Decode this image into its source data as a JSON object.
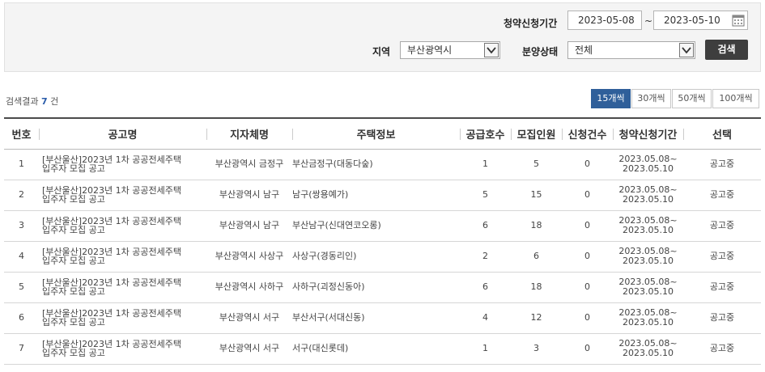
{
  "filters": {
    "period_label": "청약신청기간",
    "date_from": "2023-05-08",
    "date_sep": "~",
    "date_to": "2023-05-10",
    "region_label": "지역",
    "region_value": "부산광역시",
    "status_label": "분양상태",
    "status_value": "전체",
    "search_button": "검색"
  },
  "result": {
    "prefix": "검색결과",
    "count": "7",
    "suffix": "건"
  },
  "page_sizes": [
    "15개씩",
    "30개씩",
    "50개씩",
    "100개씩"
  ],
  "active_page_size": "15개씩",
  "table": {
    "headers": [
      "번호",
      "공고명",
      "지자체명",
      "주택정보",
      "공급호수",
      "모집인원",
      "신청건수",
      "청약신청기간",
      "선택"
    ],
    "rows": [
      {
        "no": "1",
        "title1": "[부산울산]2023년 1차 공공전세주택",
        "title2": "입주자 모집 공고",
        "gov": "부산광역시 금정구",
        "house": "부산금정구(대동다숲)",
        "supply": "1",
        "recruit": "5",
        "apply": "0",
        "date1": "2023.05.08~",
        "date2": "2023.05.10",
        "status": "공고중"
      },
      {
        "no": "2",
        "title1": "[부산울산]2023년 1차 공공전세주택",
        "title2": "입주자 모집 공고",
        "gov": "부산광역시 남구",
        "house": "남구(쌍용예가)",
        "supply": "5",
        "recruit": "15",
        "apply": "0",
        "date1": "2023.05.08~",
        "date2": "2023.05.10",
        "status": "공고중"
      },
      {
        "no": "3",
        "title1": "[부산울산]2023년 1차 공공전세주택",
        "title2": "입주자 모집 공고",
        "gov": "부산광역시 남구",
        "house": "부산남구(신대연코오롱)",
        "supply": "6",
        "recruit": "18",
        "apply": "0",
        "date1": "2023.05.08~",
        "date2": "2023.05.10",
        "status": "공고중"
      },
      {
        "no": "4",
        "title1": "[부산울산]2023년 1차 공공전세주택",
        "title2": "입주자 모집 공고",
        "gov": "부산광역시 사상구",
        "house": "사상구(경동리인)",
        "supply": "2",
        "recruit": "6",
        "apply": "0",
        "date1": "2023.05.08~",
        "date2": "2023.05.10",
        "status": "공고중"
      },
      {
        "no": "5",
        "title1": "[부산울산]2023년 1차 공공전세주택",
        "title2": "입주자 모집 공고",
        "gov": "부산광역시 사하구",
        "house": "사하구(괴정신동아)",
        "supply": "6",
        "recruit": "18",
        "apply": "0",
        "date1": "2023.05.08~",
        "date2": "2023.05.10",
        "status": "공고중"
      },
      {
        "no": "6",
        "title1": "[부산울산]2023년 1차 공공전세주택",
        "title2": "입주자 모집 공고",
        "gov": "부산광역시 서구",
        "house": "부산서구(서대신동)",
        "supply": "4",
        "recruit": "12",
        "apply": "0",
        "date1": "2023.05.08~",
        "date2": "2023.05.10",
        "status": "공고중"
      },
      {
        "no": "7",
        "title1": "[부산울산]2023년 1차 공공전세주택",
        "title2": "입주자 모집 공고",
        "gov": "부산광역시 서구",
        "house": "서구(대신롯데)",
        "supply": "1",
        "recruit": "3",
        "apply": "0",
        "date1": "2023.05.08~",
        "date2": "2023.05.10",
        "status": "공고중"
      }
    ]
  }
}
